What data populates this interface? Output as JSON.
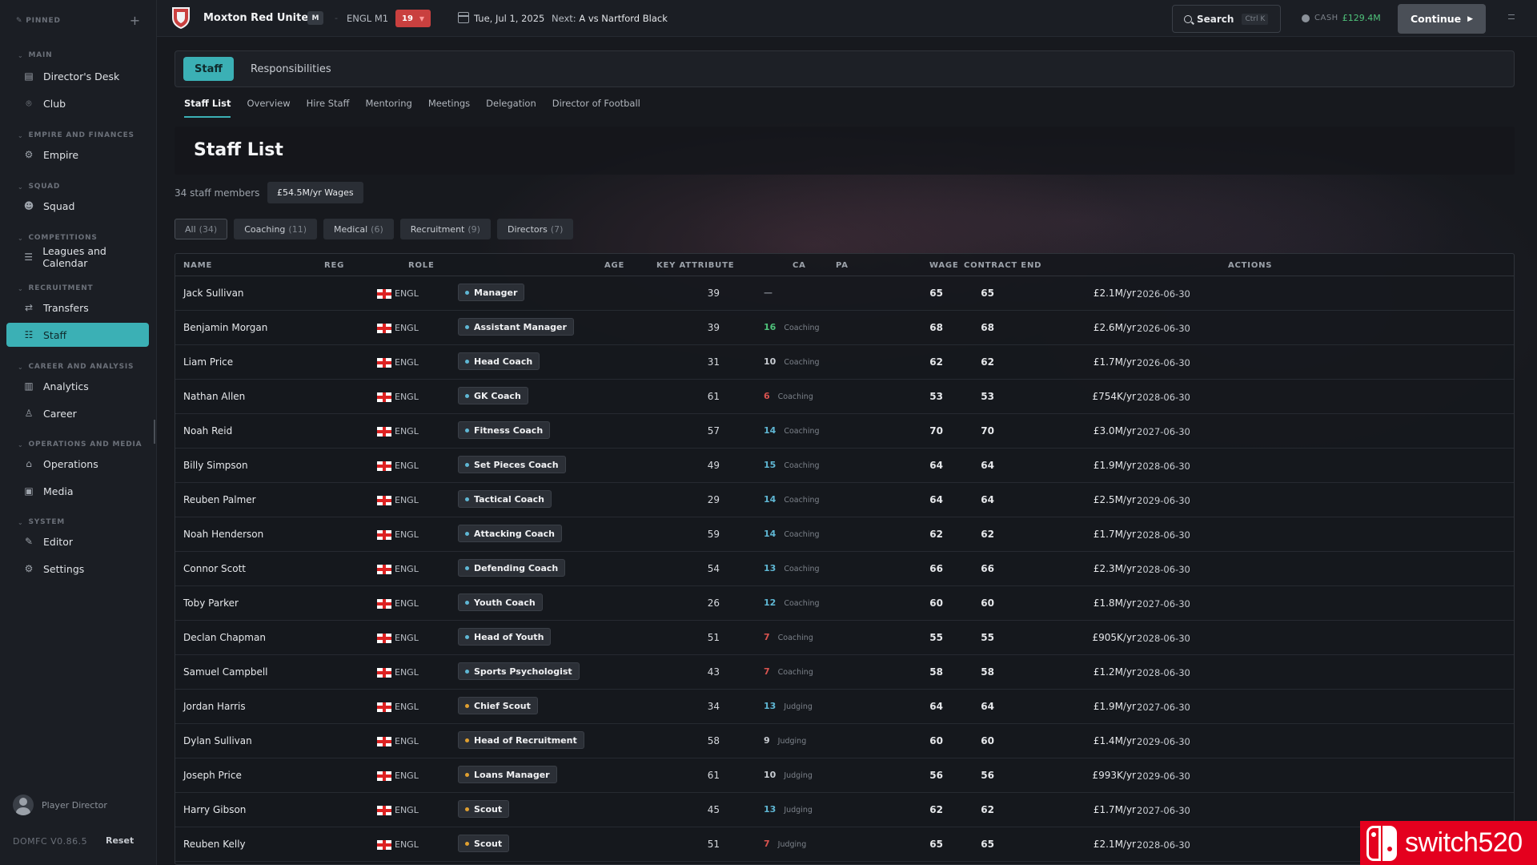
{
  "sidebar": {
    "pinned_label": "PINNED",
    "sections": [
      {
        "label": "MAIN",
        "items": [
          {
            "label": "Director's Desk",
            "icon": "clipboard-icon"
          },
          {
            "label": "Club",
            "icon": "pin-icon"
          }
        ]
      },
      {
        "label": "EMPIRE AND FINANCES",
        "items": [
          {
            "label": "Empire",
            "icon": "gear-icon"
          }
        ]
      },
      {
        "label": "SQUAD",
        "items": [
          {
            "label": "Squad",
            "icon": "users-icon"
          }
        ]
      },
      {
        "label": "COMPETITIONS",
        "items": [
          {
            "label": "Leagues and Calendar",
            "icon": "list-icon"
          }
        ]
      },
      {
        "label": "RECRUITMENT",
        "items": [
          {
            "label": "Transfers",
            "icon": "swap-icon"
          },
          {
            "label": "Staff",
            "icon": "staff-icon"
          }
        ]
      },
      {
        "label": "CAREER AND ANALYSIS",
        "items": [
          {
            "label": "Analytics",
            "icon": "bar-chart-icon"
          },
          {
            "label": "Career",
            "icon": "person-icon"
          }
        ]
      },
      {
        "label": "OPERATIONS AND MEDIA",
        "items": [
          {
            "label": "Operations",
            "icon": "building-icon"
          },
          {
            "label": "Media",
            "icon": "newspaper-icon"
          }
        ]
      },
      {
        "label": "SYSTEM",
        "items": [
          {
            "label": "Editor",
            "icon": "pencil-icon"
          },
          {
            "label": "Settings",
            "icon": "gear-icon"
          }
        ]
      }
    ],
    "active_item": "Staff",
    "user_label": "Player Director",
    "version": "DOMFC V0.86.5",
    "reset_label": "Reset"
  },
  "topbar": {
    "club_name": "Moxton Red United",
    "club_badge": "M",
    "separator": "-",
    "league": "ENGL M1",
    "position": "19",
    "position_arrow": "▼",
    "date": "Tue, Jul 1, 2025",
    "next_label": "Next:",
    "next_venue": "A",
    "next_opponent": "vs Nartford Black",
    "search_label": "Search",
    "search_shortcut": "Ctrl K",
    "cash_label": "CASH",
    "cash_amount": "£129.4M",
    "continue_label": "Continue",
    "accent_color": "#3bb0b5",
    "cash_color": "#4fc27a"
  },
  "tabs": [
    {
      "label": "Staff",
      "active": true
    },
    {
      "label": "Responsibilities",
      "active": false
    }
  ],
  "subnav": [
    {
      "label": "Staff List",
      "active": true
    },
    {
      "label": "Overview"
    },
    {
      "label": "Hire Staff"
    },
    {
      "label": "Mentoring"
    },
    {
      "label": "Meetings"
    },
    {
      "label": "Delegation"
    },
    {
      "label": "Director of Football"
    }
  ],
  "page_title": "Staff List",
  "staff_count": "34 staff members",
  "wages_total": "£54.5M/yr Wages",
  "filters": [
    {
      "label": "All",
      "count": "(34)",
      "active": true
    },
    {
      "label": "Coaching",
      "count": "(11)"
    },
    {
      "label": "Medical",
      "count": "(6)"
    },
    {
      "label": "Recruitment",
      "count": "(9)"
    },
    {
      "label": "Directors",
      "count": "(7)"
    }
  ],
  "table": {
    "columns": {
      "name": "NAME",
      "reg": "REG",
      "role": "ROLE",
      "age": "AGE",
      "key": "KEY ATTRIBUTE",
      "ca": "CA",
      "pa": "PA",
      "wage": "WAGE",
      "contract": "CONTRACT END",
      "actions": "ACTIONS"
    },
    "rows": [
      {
        "name": "Jack Sullivan",
        "reg": "ENGL",
        "role": "Manager",
        "role_color": "#5fb7d4",
        "age": "39",
        "key_value": "—",
        "key_label": "",
        "key_color": "#7c828a",
        "ca": "65",
        "pa": "65",
        "wage": "£2.1M/yr",
        "contract": "2026-06-30"
      },
      {
        "name": "Benjamin Morgan",
        "reg": "ENGL",
        "role": "Assistant Manager",
        "role_color": "#5fb7d4",
        "age": "39",
        "key_value": "16",
        "key_label": "Coaching",
        "key_color": "#4fc27a",
        "ca": "68",
        "pa": "68",
        "wage": "£2.6M/yr",
        "contract": "2026-06-30"
      },
      {
        "name": "Liam Price",
        "reg": "ENGL",
        "role": "Head Coach",
        "role_color": "#5fb7d4",
        "age": "31",
        "key_value": "10",
        "key_label": "Coaching",
        "key_color": "#c9cdd3",
        "ca": "62",
        "pa": "62",
        "wage": "£1.7M/yr",
        "contract": "2026-06-30"
      },
      {
        "name": "Nathan Allen",
        "reg": "ENGL",
        "role": "GK Coach",
        "role_color": "#5fb7d4",
        "age": "61",
        "key_value": "6",
        "key_label": "Coaching",
        "key_color": "#d9534f",
        "ca": "53",
        "pa": "53",
        "wage": "£754K/yr",
        "contract": "2028-06-30"
      },
      {
        "name": "Noah Reid",
        "reg": "ENGL",
        "role": "Fitness Coach",
        "role_color": "#5fb7d4",
        "age": "57",
        "key_value": "14",
        "key_label": "Coaching",
        "key_color": "#5fb7d4",
        "ca": "70",
        "pa": "70",
        "wage": "£3.0M/yr",
        "contract": "2027-06-30"
      },
      {
        "name": "Billy Simpson",
        "reg": "ENGL",
        "role": "Set Pieces Coach",
        "role_color": "#5fb7d4",
        "age": "49",
        "key_value": "15",
        "key_label": "Coaching",
        "key_color": "#5fb7d4",
        "ca": "64",
        "pa": "64",
        "wage": "£1.9M/yr",
        "contract": "2028-06-30"
      },
      {
        "name": "Reuben Palmer",
        "reg": "ENGL",
        "role": "Tactical Coach",
        "role_color": "#5fb7d4",
        "age": "29",
        "key_value": "14",
        "key_label": "Coaching",
        "key_color": "#5fb7d4",
        "ca": "64",
        "pa": "64",
        "wage": "£2.5M/yr",
        "contract": "2029-06-30"
      },
      {
        "name": "Noah Henderson",
        "reg": "ENGL",
        "role": "Attacking Coach",
        "role_color": "#5fb7d4",
        "age": "59",
        "key_value": "14",
        "key_label": "Coaching",
        "key_color": "#5fb7d4",
        "ca": "62",
        "pa": "62",
        "wage": "£1.7M/yr",
        "contract": "2028-06-30"
      },
      {
        "name": "Connor Scott",
        "reg": "ENGL",
        "role": "Defending Coach",
        "role_color": "#5fb7d4",
        "age": "54",
        "key_value": "13",
        "key_label": "Coaching",
        "key_color": "#5fb7d4",
        "ca": "66",
        "pa": "66",
        "wage": "£2.3M/yr",
        "contract": "2028-06-30"
      },
      {
        "name": "Toby Parker",
        "reg": "ENGL",
        "role": "Youth Coach",
        "role_color": "#5fb7d4",
        "age": "26",
        "key_value": "12",
        "key_label": "Coaching",
        "key_color": "#5fb7d4",
        "ca": "60",
        "pa": "60",
        "wage": "£1.8M/yr",
        "contract": "2027-06-30"
      },
      {
        "name": "Declan Chapman",
        "reg": "ENGL",
        "role": "Head of Youth",
        "role_color": "#5fb7d4",
        "age": "51",
        "key_value": "7",
        "key_label": "Coaching",
        "key_color": "#d9534f",
        "ca": "55",
        "pa": "55",
        "wage": "£905K/yr",
        "contract": "2028-06-30"
      },
      {
        "name": "Samuel Campbell",
        "reg": "ENGL",
        "role": "Sports Psychologist",
        "role_color": "#5fb7d4",
        "age": "43",
        "key_value": "7",
        "key_label": "Coaching",
        "key_color": "#d9534f",
        "ca": "58",
        "pa": "58",
        "wage": "£1.2M/yr",
        "contract": "2028-06-30"
      },
      {
        "name": "Jordan Harris",
        "reg": "ENGL",
        "role": "Chief Scout",
        "role_color": "#e0a030",
        "age": "34",
        "key_value": "13",
        "key_label": "Judging",
        "key_color": "#5fb7d4",
        "ca": "64",
        "pa": "64",
        "wage": "£1.9M/yr",
        "contract": "2027-06-30"
      },
      {
        "name": "Dylan Sullivan",
        "reg": "ENGL",
        "role": "Head of Recruitment",
        "role_color": "#e0a030",
        "age": "58",
        "key_value": "9",
        "key_label": "Judging",
        "key_color": "#c9cdd3",
        "ca": "60",
        "pa": "60",
        "wage": "£1.4M/yr",
        "contract": "2029-06-30"
      },
      {
        "name": "Joseph Price",
        "reg": "ENGL",
        "role": "Loans Manager",
        "role_color": "#e0a030",
        "age": "61",
        "key_value": "10",
        "key_label": "Judging",
        "key_color": "#c9cdd3",
        "ca": "56",
        "pa": "56",
        "wage": "£993K/yr",
        "contract": "2029-06-30"
      },
      {
        "name": "Harry Gibson",
        "reg": "ENGL",
        "role": "Scout",
        "role_color": "#e0a030",
        "age": "45",
        "key_value": "13",
        "key_label": "Judging",
        "key_color": "#5fb7d4",
        "ca": "62",
        "pa": "62",
        "wage": "£1.7M/yr",
        "contract": "2027-06-30"
      },
      {
        "name": "Reuben Kelly",
        "reg": "ENGL",
        "role": "Scout",
        "role_color": "#e0a030",
        "age": "51",
        "key_value": "7",
        "key_label": "Judging",
        "key_color": "#d9534f",
        "ca": "65",
        "pa": "65",
        "wage": "£2.1M/yr",
        "contract": "2028-06-30"
      }
    ]
  },
  "watermark": {
    "text": "switch520"
  }
}
